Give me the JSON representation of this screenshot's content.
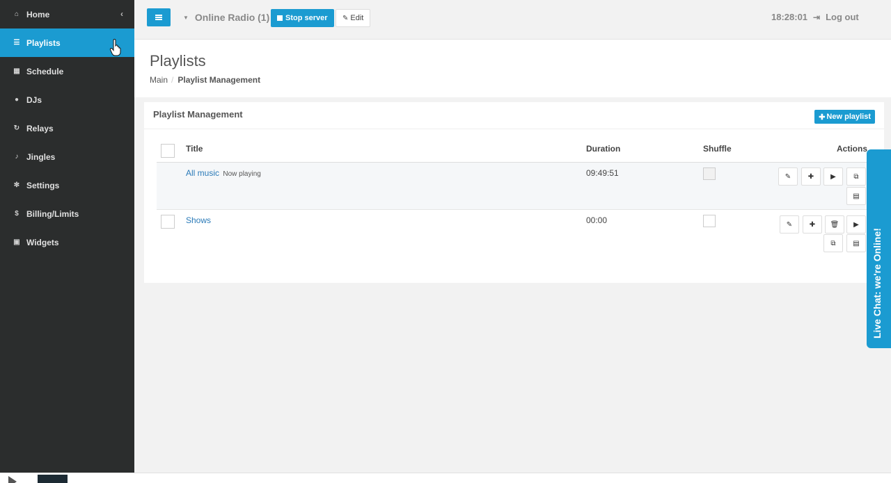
{
  "sidebar": {
    "items": [
      {
        "label": "Home",
        "icon": "home-icon"
      },
      {
        "label": "Playlists",
        "icon": "list-icon",
        "active": true
      },
      {
        "label": "Schedule",
        "icon": "calendar-icon"
      },
      {
        "label": "DJs",
        "icon": "user-icon"
      },
      {
        "label": "Relays",
        "icon": "refresh-icon"
      },
      {
        "label": "Jingles",
        "icon": "bell-icon"
      },
      {
        "label": "Settings",
        "icon": "cogs-icon"
      },
      {
        "label": "Billing/Limits",
        "icon": "dollar-icon"
      },
      {
        "label": "Widgets",
        "icon": "gift-icon"
      }
    ],
    "collapse_glyph": "‹"
  },
  "topbar": {
    "station": "Online Radio (1)",
    "stop_label": "Stop server",
    "edit_label": "Edit",
    "clock": "18:28:01",
    "logout_label": "Log out"
  },
  "page": {
    "title": "Playlists",
    "breadcrumb": {
      "root": "Main",
      "current": "Playlist Management"
    }
  },
  "panel": {
    "title": "Playlist Management",
    "new_label": "New playlist",
    "columns": {
      "title": "Title",
      "duration": "Duration",
      "shuffle": "Shuffle",
      "actions": "Actions"
    },
    "rows": [
      {
        "title": "All music",
        "status": "Now playing",
        "duration": "09:49:51",
        "shuffle": false
      },
      {
        "title": "Shows",
        "status": "",
        "duration": "00:00",
        "shuffle": false
      }
    ]
  },
  "livechat": {
    "label": "Live Chat: we're Online!"
  },
  "colors": {
    "accent": "#1b9bd1",
    "sidebar": "#2b2d2d",
    "link": "#2a7ab8"
  }
}
